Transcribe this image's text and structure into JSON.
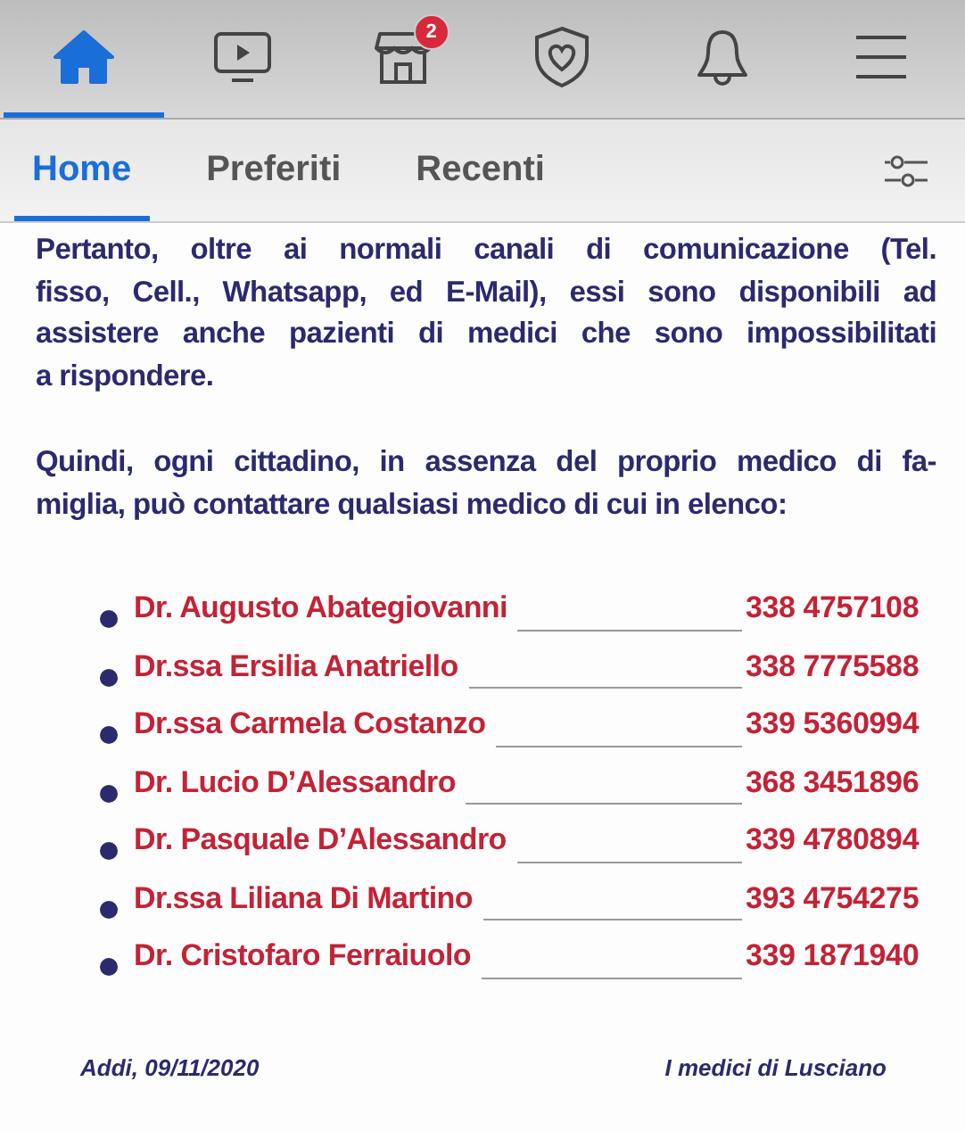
{
  "nav": [
    {
      "kind": "home",
      "selected": true
    },
    {
      "kind": "video",
      "selected": false
    },
    {
      "kind": "store",
      "selected": false,
      "badge": "2"
    },
    {
      "kind": "shield",
      "selected": false
    },
    {
      "kind": "bell",
      "selected": false
    },
    {
      "kind": "menu",
      "selected": false
    }
  ],
  "tabs": [
    {
      "label": "Home",
      "selected": true
    },
    {
      "label": "Preferiti",
      "selected": false
    },
    {
      "label": "Recenti",
      "selected": false
    }
  ],
  "post": {
    "paragraphs": [
      [
        "Pertanto, oltre ai normali canali di comunicazione (Tel.",
        "fisso, Cell., Whatsapp, ed E-Mail), essi sono disponibili ad",
        "assistere anche pazienti di medici che sono impossibilitati",
        "a rispondere."
      ],
      [
        "Quindi, ogni cittadino, in assenza del proprio medico di fa-",
        "miglia, può contattare qualsiasi medico di cui in elenco:"
      ]
    ],
    "doctors": [
      {
        "name": "Dr. Augusto Abategiovanni",
        "phone": "338 4757108"
      },
      {
        "name": "Dr.ssa Ersilia Anatriello",
        "phone": "338 7775588"
      },
      {
        "name": "Dr.ssa Carmela Costanzo",
        "phone": "339 5360994"
      },
      {
        "name": "Dr. Lucio D’Alessandro",
        "phone": "368 3451896"
      },
      {
        "name": "Dr. Pasquale D’Alessandro",
        "phone": "339 4780894"
      },
      {
        "name": "Dr.ssa Liliana Di Martino",
        "phone": "393 4754275"
      },
      {
        "name": "Dr. Cristofaro Ferraiuolo",
        "phone": "339 1871940"
      }
    ],
    "date": "Addi, 09/11/2020",
    "signature": "I medici di Lusciano"
  }
}
